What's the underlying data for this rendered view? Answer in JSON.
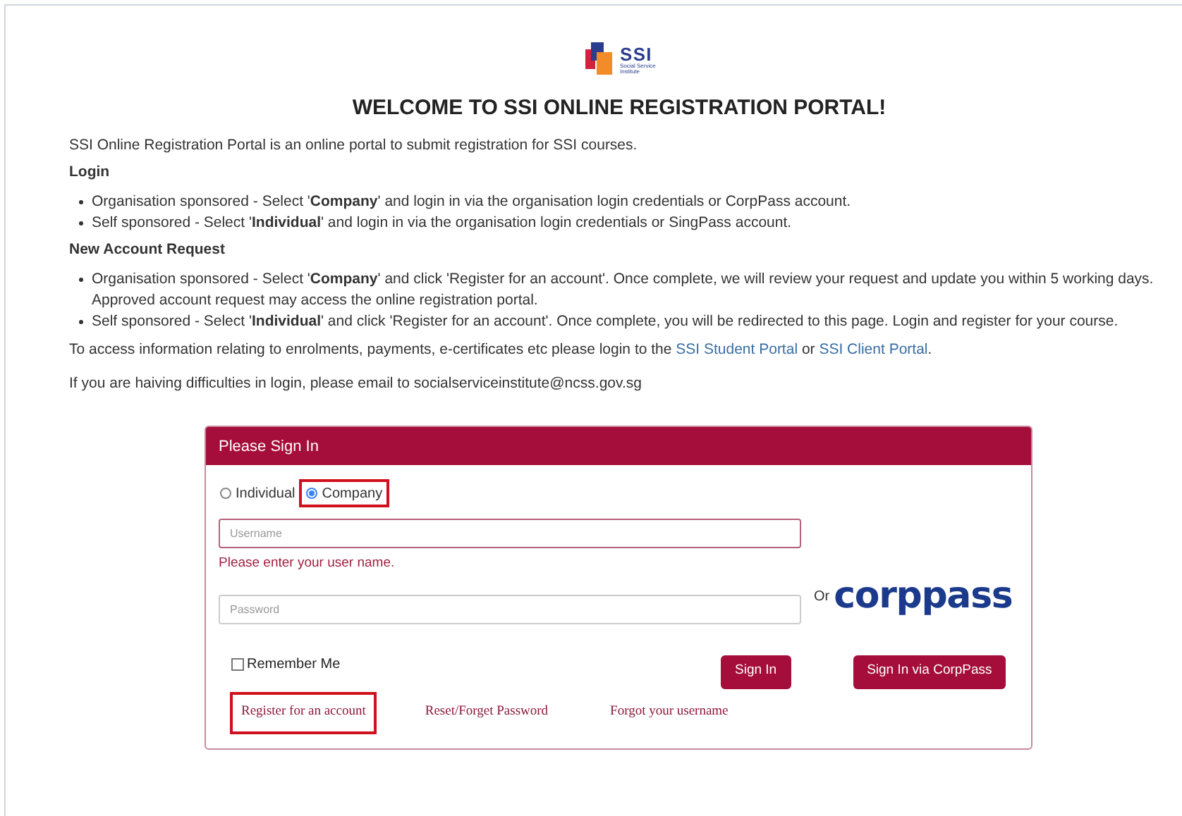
{
  "logo": {
    "name": "SSI",
    "subtitle": "Social Service Institute"
  },
  "title": "WELCOME TO SSI ONLINE REGISTRATION PORTAL!",
  "intro": "SSI Online Registration Portal is an online portal to submit registration for SSI courses.",
  "sections": [
    {
      "heading": "Login",
      "bullets": [
        "Organisation sponsored - Select '**Company**' and login in via the organisation login credentials or CorpPass account.",
        "Self sponsored - Select '**Individual**' and  login in via the organisation login credentials or SingPass account."
      ]
    },
    {
      "heading": "New Account Request",
      "bullets": [
        "Organisation sponsored -  Select '**Company**' and click 'Register for an account'. Once complete, we will review your request and update you within 5 working days. Approved account request may access the online registration portal.",
        "Self sponsored - Select '**Individual**' and  click 'Register for an account'. Once complete, you will be redirected to this page. Login and register for your course."
      ]
    }
  ],
  "access_note": {
    "text": "To access information relating to enrolments, payments, e-certificates etc please login to the",
    "link1": "SSI Student Portal",
    "middle": "or",
    "link2": "SSI Client Portal",
    "end": "."
  },
  "help_note": "If you are haiving difficulties in login, please email to socialserviceinstitute@ncss.gov.sg",
  "sign_in": {
    "header": "Please Sign In",
    "account_types": [
      {
        "label": "Individual",
        "selected": false,
        "highlighted": false
      },
      {
        "label": "Company",
        "selected": true,
        "highlighted": true
      }
    ],
    "username": {
      "placeholder": "Username",
      "error": "Please enter your user name."
    },
    "password": {
      "placeholder": "Password"
    },
    "or_label": "Or",
    "corppass_logo": "corppass",
    "remember_me": {
      "label": "Remember Me",
      "checked": false
    },
    "buttons": [
      "Sign In",
      "Sign In via CorpPass"
    ],
    "links": [
      {
        "label": "Register for an account",
        "highlighted": true
      },
      {
        "label": "Reset/Forget Password",
        "highlighted": false
      },
      {
        "label": "Forgot your username",
        "highlighted": false
      }
    ]
  }
}
